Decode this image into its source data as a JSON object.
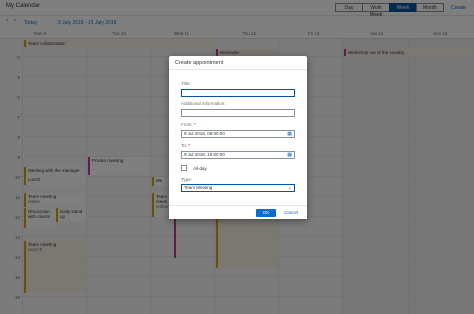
{
  "header": {
    "title": "My Calendar",
    "views": [
      "Day",
      "Work Week",
      "Week",
      "Month"
    ],
    "active_view": "Week",
    "create_label": "Create"
  },
  "nav": {
    "today_label": "Today",
    "range": "9 July 2018 - 15 July 2018",
    "prev_icon": "chevron-left-icon",
    "next_icon": "chevron-right-icon"
  },
  "days": [
    "Mon 9",
    "Tue 10",
    "Wed 11",
    "Thu 12",
    "Fri 13",
    "Sat 14",
    "Sun 15"
  ],
  "hours": [
    "0",
    "5",
    "6",
    "7",
    "8",
    "9",
    "10",
    "11",
    "12",
    "13",
    "14",
    "15",
    "16",
    "17"
  ],
  "all_day": {
    "team_collaboration": "Team collaboration",
    "reminder": "Reminder",
    "workshop": "Workshop out of the country"
  },
  "appointments": {
    "meeting_manager": "Meeting with the manager",
    "lunch": "Lunch",
    "team_meeting_1_title": "Team meeting",
    "team_meeting_1_sub": "online",
    "discussion": "Discussion with clients",
    "daily_standup": "Daily stand up",
    "team_meeting_2_title": "Team meeting",
    "team_meeting_2_sub": "room 5",
    "private_meeting": "Private meeting",
    "wed_icon_meet": "Me",
    "wed_team_1": "Team",
    "wed_team_2": "meeti",
    "wed_team_3": "online"
  },
  "dialog": {
    "title": "Create appointment",
    "title_label": "Title:",
    "title_value": "",
    "info_label": "Additional information:",
    "info_value": "",
    "from_label": "From:",
    "from_value": "9 Jul 2018, 09:00:00",
    "to_label": "To:",
    "to_value": "9 Jul 2018, 10:00:00",
    "required_mark": "*",
    "allday_label": "All-day",
    "type_label": "Type:",
    "type_value": "Team Meeting",
    "ok_label": "OK",
    "cancel_label": "Cancel"
  },
  "colors": {
    "accent": "#0a6ed1",
    "emphasized": "#0854a0",
    "orange_marker": "#e09d00",
    "pink_marker": "#c0399f"
  }
}
